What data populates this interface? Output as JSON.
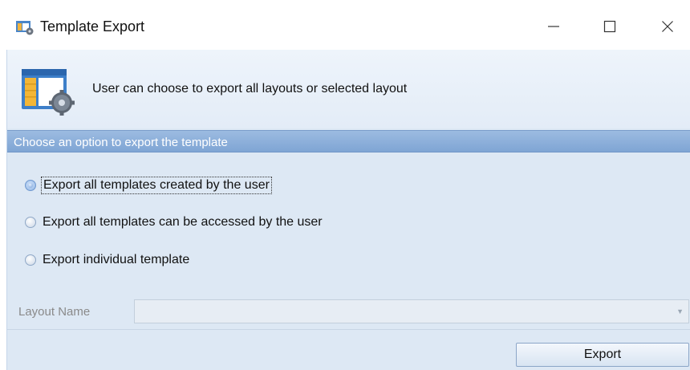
{
  "window": {
    "title": "Template Export",
    "app_icon": "template-export-app-icon",
    "controls": [
      "minimize-icon",
      "maximize-icon",
      "close-icon"
    ]
  },
  "header": {
    "icon": "layout-settings-icon",
    "description": "User can choose to export all layouts or selected layout"
  },
  "section": {
    "title": "Choose an option to export the template"
  },
  "options": [
    {
      "label": "Export all templates created by the user",
      "checked": true
    },
    {
      "label": "Export all templates can be accessed by the user",
      "checked": false
    },
    {
      "label": "Export individual template",
      "checked": false
    }
  ],
  "layout_name": {
    "label": "Layout Name",
    "value": "",
    "enabled": false
  },
  "buttons": {
    "export_label": "Export"
  },
  "colors": {
    "section_bar": "#8fb2dd",
    "body_background": "#dde8f4"
  }
}
